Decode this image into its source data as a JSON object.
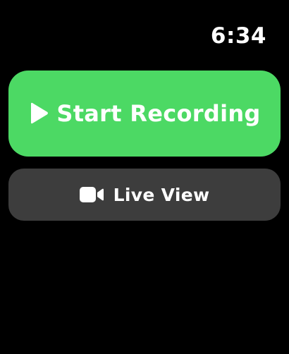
{
  "status_bar": {
    "time": "6:34"
  },
  "buttons": {
    "start_recording": {
      "label": "Start Recording",
      "icon": "play-icon",
      "background": "#4cd964"
    },
    "live_view": {
      "label": "Live View",
      "icon": "video-camera-icon",
      "background": "#3d3d3d"
    }
  },
  "colors": {
    "background": "#000000",
    "text": "#ffffff",
    "accent_green": "#4cd964",
    "secondary_gray": "#3d3d3d"
  }
}
